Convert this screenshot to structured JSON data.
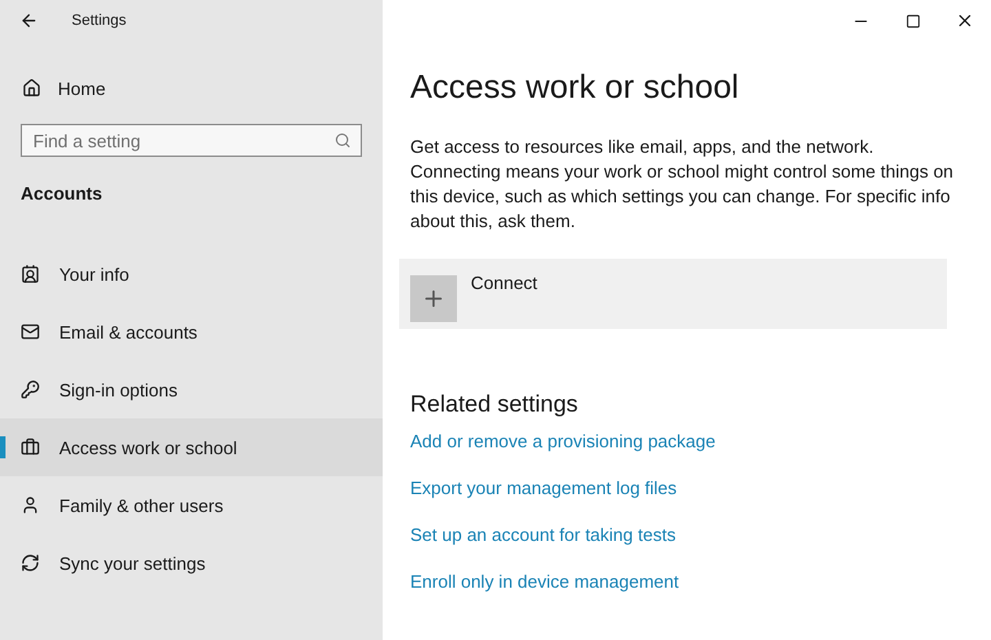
{
  "window": {
    "title": "Settings"
  },
  "sidebar": {
    "home": "Home",
    "search": {
      "placeholder": "Find a setting"
    },
    "section": "Accounts",
    "items": [
      {
        "label": "Your info",
        "selected": false
      },
      {
        "label": "Email & accounts",
        "selected": false
      },
      {
        "label": "Sign-in options",
        "selected": false
      },
      {
        "label": "Access work or school",
        "selected": true
      },
      {
        "label": "Family & other users",
        "selected": false
      },
      {
        "label": "Sync your settings",
        "selected": false
      }
    ]
  },
  "main": {
    "title": "Access work or school",
    "description": "Get access to resources like email, apps, and the network. Connecting means your work or school might control some things on this device, such as which settings you can change. For specific info about this, ask them.",
    "connect": "Connect",
    "related": {
      "title": "Related settings",
      "links": [
        "Add or remove a provisioning package",
        "Export your management log files",
        "Set up an account for taking tests",
        "Enroll only in device management"
      ]
    }
  }
}
